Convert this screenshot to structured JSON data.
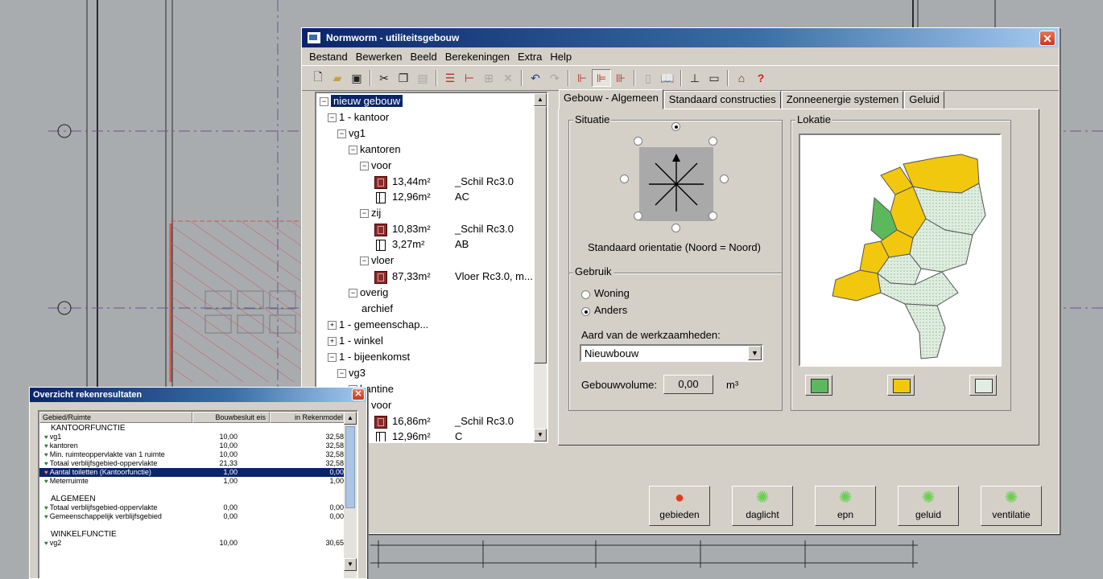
{
  "main_window": {
    "title": "Normworm - utiliteitsgebouw",
    "close": "✕",
    "menu": [
      "Bestand",
      "Bewerken",
      "Beeld",
      "Berekeningen",
      "Extra",
      "Help"
    ],
    "toolbar_icons": [
      "new-icon",
      "open-icon",
      "save-icon",
      "cut-icon",
      "copy-icon",
      "paste-icon",
      "tree-add-icon",
      "tree-branch-icon",
      "table-icon",
      "delete-icon",
      "undo-icon",
      "redo-icon",
      "tree-view-1-icon",
      "tree-view-2-icon",
      "tree-view-3-icon",
      "page-icon",
      "book-icon",
      "level-icon",
      "window-icon",
      "house-icon",
      "help-icon"
    ]
  },
  "tree": {
    "root": "nieuw gebouw",
    "kantoor": "1 - kantoor",
    "vg1": "vg1",
    "kantoren": "kantoren",
    "voor": "voor",
    "voor_wall_area": "13,44m²",
    "voor_wall_name": "_Schil Rc3.0",
    "voor_win_area": "12,96m²",
    "voor_win_name": "AC",
    "zij": "zij",
    "zij_wall_area": "10,83m²",
    "zij_wall_name": "_Schil Rc3.0",
    "zij_win_area": "3,27m²",
    "zij_win_name": "AB",
    "vloer": "vloer",
    "vloer_area": "87,33m²",
    "vloer_name": "Vloer Rc3.0, m...",
    "overig": "overig",
    "archief": "archief",
    "gemeenschap": "1 - gemeenschap...",
    "winkel": "1 - winkel",
    "bijeenkomst": "1 - bijeenkomst",
    "vg": "vg3",
    "kantine": "kantine",
    "voor2": "voor",
    "voor2_wall_area": "16,86m²",
    "voor2_wall_name": "_Schil Rc3.0",
    "voor2_win_area": "12,96m²",
    "voor2_win_name": "C"
  },
  "tabs": [
    "Gebouw - Algemeen",
    "Standaard constructies",
    "Zonneenergie systemen",
    "Geluid"
  ],
  "situatie": {
    "title": "Situatie",
    "caption": "Standaard orientatie (Noord = Noord)"
  },
  "lokatie": {
    "title": "Lokatie"
  },
  "gebruik": {
    "title": "Gebruik",
    "options": [
      "Woning",
      "Anders"
    ],
    "selected": "Anders",
    "aard_label": "Aard van de werkzaamheden:",
    "aard_value": "Nieuwbouw",
    "volume_label": "Gebouwvolume:",
    "volume_value": "0,00",
    "volume_unit": "m³"
  },
  "map_colors": {
    "green": "#5cb85c",
    "yellow": "#f2c80f",
    "pale": "#dfeee0"
  },
  "bottom_buttons": [
    {
      "label": "gebieden",
      "icon": "bulb-red-icon",
      "color": "#e53b1c"
    },
    {
      "label": "daglicht",
      "icon": "bulb-green-icon",
      "color": "#6ccf52"
    },
    {
      "label": "epn",
      "icon": "bulb-green-icon",
      "color": "#6ccf52"
    },
    {
      "label": "geluid",
      "icon": "bulb-green-icon",
      "color": "#6ccf52"
    },
    {
      "label": "ventilatie",
      "icon": "bulb-green-icon",
      "color": "#6ccf52"
    }
  ],
  "results_window": {
    "title": "Overzicht rekenresultaten",
    "close": "✕",
    "columns": [
      "Gebied/Ruimte",
      "Bouwbesluit eis",
      "in Rekenmodel"
    ],
    "rows": [
      {
        "type": "section",
        "name": "KANTOORFUNCTIE"
      },
      {
        "type": "item",
        "name": "vg1",
        "eis": "10,00",
        "model": "32,58"
      },
      {
        "type": "item",
        "name": "kantoren",
        "eis": "10,00",
        "model": "32,58"
      },
      {
        "type": "item",
        "name": "Min. ruimteoppervlakte van 1 ruimte",
        "eis": "10,00",
        "model": "32,58"
      },
      {
        "type": "item",
        "name": "Totaal verblijfsgebied-oppervlakte",
        "eis": "21,33",
        "model": "32,58"
      },
      {
        "type": "item",
        "name": "Aantal toiletten (Kantoorfunctie)",
        "eis": "1,00",
        "model": "0,00",
        "highlight": true
      },
      {
        "type": "item",
        "name": "Meterruimte",
        "eis": "1,00",
        "model": "1,00"
      },
      {
        "type": "blank"
      },
      {
        "type": "section",
        "name": "ALGEMEEN"
      },
      {
        "type": "item",
        "name": "Totaal verblijfsgebied-oppervlakte",
        "eis": "0,00",
        "model": "0,00"
      },
      {
        "type": "item",
        "name": "Gemeenschappelijk verblijfsgebied",
        "eis": "0,00",
        "model": "0,00"
      },
      {
        "type": "blank"
      },
      {
        "type": "section",
        "name": "WINKELFUNCTIE"
      },
      {
        "type": "item",
        "name": "vg2",
        "eis": "10,00",
        "model": "30,65"
      }
    ]
  }
}
